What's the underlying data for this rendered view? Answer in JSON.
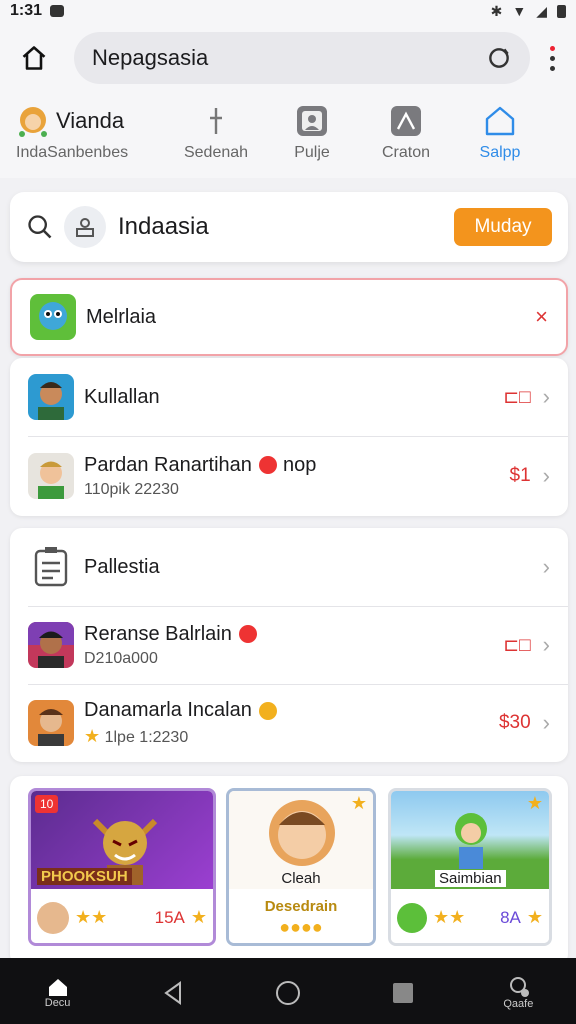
{
  "status": {
    "time": "1:31"
  },
  "topbar": {
    "search_text": "Nepagsasia"
  },
  "categories": [
    {
      "label": "IndaSanbenbes",
      "title": "Vianda",
      "icon": "avatar-icon"
    },
    {
      "label": "Sedenah",
      "icon": "tool-icon"
    },
    {
      "label": "Pulje",
      "icon": "image-icon"
    },
    {
      "label": "Craton",
      "icon": "hanger-icon"
    },
    {
      "label": "Salpp",
      "icon": "house-icon"
    }
  ],
  "main_search": {
    "label": "Indaasia",
    "button": "Muday"
  },
  "selected": {
    "title": "Melrlaia"
  },
  "list1": [
    {
      "title": "Kullallan",
      "sub": "",
      "price": ""
    },
    {
      "title": "Pardan Ranartihan",
      "title_suffix": "nop",
      "sub": "110pik 22230",
      "price": "$1"
    }
  ],
  "list2": [
    {
      "title": "Pallestia",
      "sub": "",
      "price": ""
    },
    {
      "title": "Reranse Balrlain",
      "sub": "D210a000",
      "price": ""
    },
    {
      "title": "Danamarla Incalan",
      "sub": "1lpe 1:2230",
      "price": "$30"
    }
  ],
  "games": [
    {
      "badge": "10",
      "name": "PHOOKSUH",
      "price": "15A"
    },
    {
      "name": "Cleah",
      "sub": "Desedrain"
    },
    {
      "name": "Saimbian",
      "price": "8A"
    }
  ],
  "nav": {
    "home_label": "Decu",
    "profile_label": "Qaafe"
  },
  "colors": {
    "accent": "#f3941d",
    "price": "#d33333",
    "link": "#2f8ce8"
  }
}
